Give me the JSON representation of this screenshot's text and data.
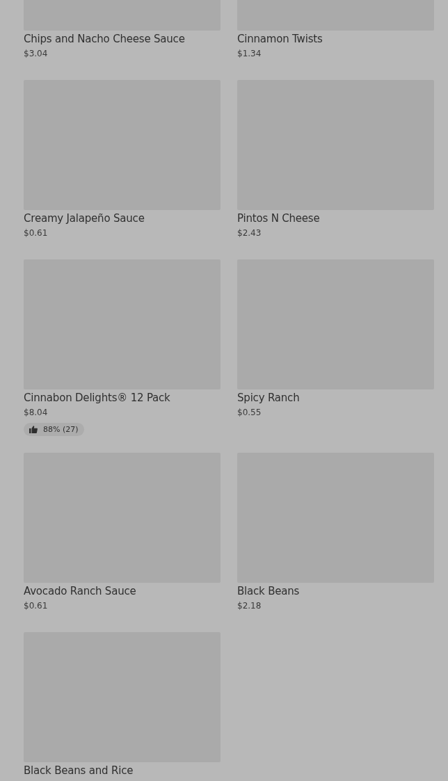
{
  "items": [
    {
      "name": "Chips and Nacho Cheese Sauce",
      "price": "$3.04"
    },
    {
      "name": "Cinnamon Twists",
      "price": "$1.34"
    },
    {
      "name": "Creamy Jalapeño Sauce",
      "price": "$0.61"
    },
    {
      "name": "Pintos N Cheese",
      "price": "$2.43"
    },
    {
      "name": "Cinnabon Delights® 12 Pack",
      "price": "$8.04",
      "rating": "88% (27)"
    },
    {
      "name": "Spicy Ranch",
      "price": "$0.55"
    },
    {
      "name": "Avocado Ranch Sauce",
      "price": "$0.61"
    },
    {
      "name": "Black Beans",
      "price": "$2.18"
    },
    {
      "name": "Black Beans and Rice"
    }
  ]
}
